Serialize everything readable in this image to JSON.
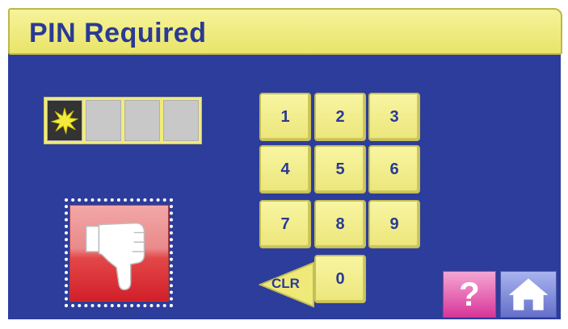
{
  "title": "PIN Required",
  "pin": {
    "length": 4,
    "entered": 1
  },
  "keypad": {
    "keys": [
      "1",
      "2",
      "3",
      "4",
      "5",
      "6",
      "7",
      "8",
      "9",
      "0"
    ],
    "clear_label": "CLR"
  },
  "help": {
    "label": "?"
  },
  "icons": {
    "entered_digit": "star-icon",
    "status": "thumbs-down-icon",
    "clear": "back-arrow-icon",
    "help": "question-mark-icon",
    "home": "house-icon"
  },
  "colors": {
    "background": "#2d3d9b",
    "title_bar": "#efea7c",
    "title_text": "#2a3a94",
    "key": "#f1ec84",
    "status_red": "#d21f2a",
    "help_pink": "#e35aac",
    "home_blue": "#8d98e0"
  }
}
